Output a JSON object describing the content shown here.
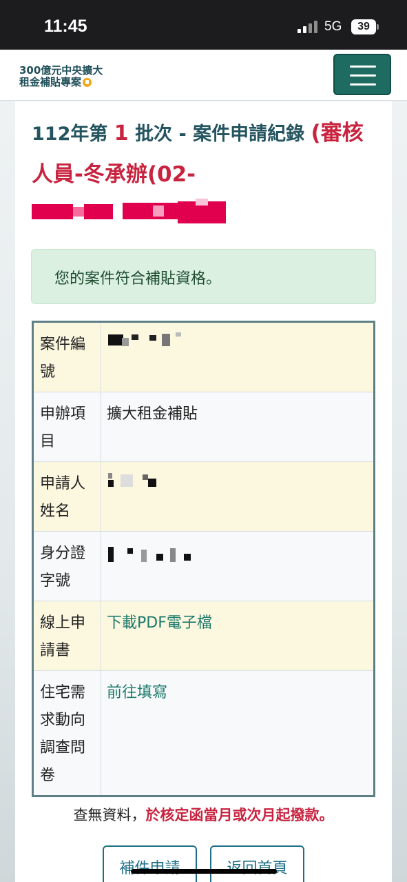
{
  "status_bar": {
    "time": "11:45",
    "network": "5G",
    "battery": "39"
  },
  "navbar": {
    "logo_line1": "300億元中央擴大",
    "logo_line2": "租金補貼專案"
  },
  "heading": {
    "prefix": "112年第",
    "batch_number": "1",
    "middle": "批次 - 案件申請紀錄",
    "reviewer": "(審核人員-冬承辦(02-"
  },
  "alert": {
    "message": "您的案件符合補貼資格。"
  },
  "table": {
    "rows": [
      {
        "label": "案件編號",
        "value": ""
      },
      {
        "label": "申辦項目",
        "value": "擴大租金補貼"
      },
      {
        "label": "申請人姓名",
        "value": ""
      },
      {
        "label": "身分證字號",
        "value": ""
      },
      {
        "label": "線上申請書",
        "value": "下載PDF電子檔"
      },
      {
        "label": "住宅需求動向調查問卷",
        "value": "前往填寫"
      }
    ]
  },
  "notice": {
    "prefix": "查無資料，",
    "highlight": "於核定函當月或次月起撥款。"
  },
  "buttons": {
    "supplement": "補件申請",
    "home": "返回首頁"
  },
  "colors": {
    "primary": "#1e6b62",
    "accent_red": "#c8233f",
    "heading": "#24545f"
  }
}
